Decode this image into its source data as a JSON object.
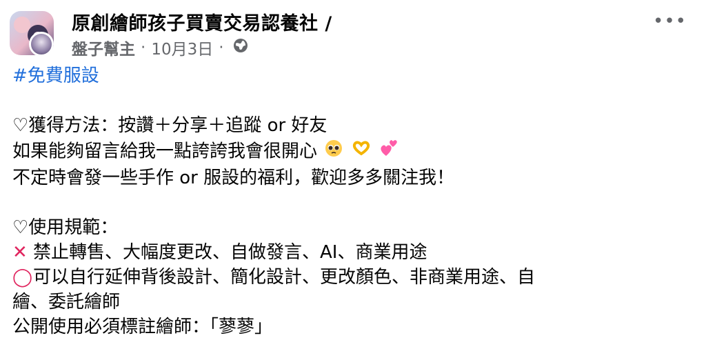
{
  "header": {
    "group_name": "原創繪師孩子買賣交易認養社 /",
    "author": "盤子幫主",
    "date": "10月3日",
    "separator": "·",
    "more_label": "•••"
  },
  "post": {
    "hashtag": "#免費服設",
    "line1": "♡獲得方法：按讚＋分享＋追蹤 or 好友",
    "line2": "如果能夠留言給我一點誇誇我會很開心",
    "line3": "不定時會發一些手作 or 服設的福利，歡迎多多關注我！",
    "line4": "♡使用規範：",
    "line5_mark": "✕",
    "line5": "禁止轉售、大幅度更改、自做發言、AI、商業用途",
    "line6_mark": "◯",
    "line6": "可以自行延伸背後設計、簡化設計、更改顏色、非商業用途、自",
    "line7": "繪、委託繪師",
    "line8": "公開使用必須標註繪師：「蓼蓼」"
  },
  "icons": {
    "globe": "globe-icon",
    "more": "more-options-icon",
    "emoji1": "pleading-face-emoji",
    "emoji2": "heart-hands-emoji",
    "emoji3": "two-hearts-emoji"
  }
}
